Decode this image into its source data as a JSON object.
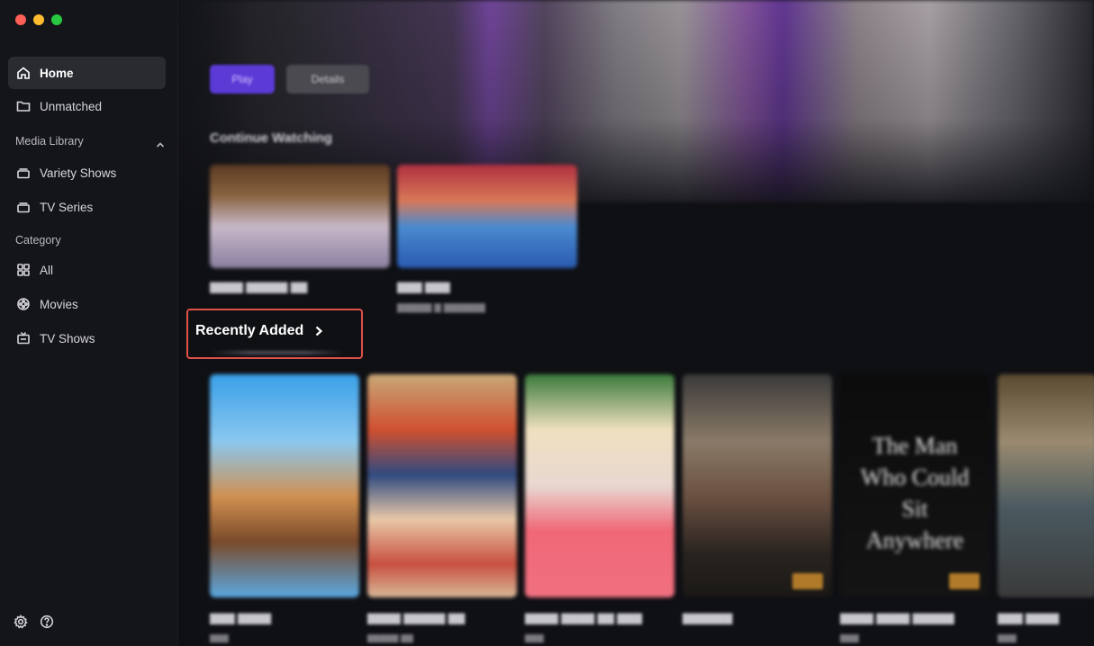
{
  "window": {
    "controls": [
      "close",
      "minimize",
      "zoom"
    ]
  },
  "sidebar": {
    "items": [
      {
        "label": "Home",
        "icon": "home-icon",
        "active": true
      },
      {
        "label": "Unmatched",
        "icon": "folder-icon",
        "active": false
      }
    ],
    "media_library": {
      "label": "Media Library",
      "items": [
        {
          "label": "Variety Shows",
          "icon": "library-stack-icon"
        },
        {
          "label": "TV Series",
          "icon": "library-stack-icon"
        }
      ]
    },
    "category": {
      "label": "Category",
      "items": [
        {
          "label": "All",
          "icon": "grid-icon"
        },
        {
          "label": "Movies",
          "icon": "film-reel-icon"
        },
        {
          "label": "TV Shows",
          "icon": "tv-icon"
        }
      ]
    },
    "footer_icons": [
      "settings-gear-icon",
      "help-question-icon"
    ]
  },
  "main": {
    "hero": {
      "play_label": "Play",
      "details_label": "Details"
    },
    "continue_watching": {
      "title": "Continue Watching"
    },
    "recently_added": {
      "title": "Recently Added"
    },
    "poster5_text": "The Man Who Could Sit Anywhere",
    "colors": {
      "accent": "#5b3ad6",
      "highlight_border": "#e0504a",
      "sidebar_active": "#2a2b31"
    }
  }
}
